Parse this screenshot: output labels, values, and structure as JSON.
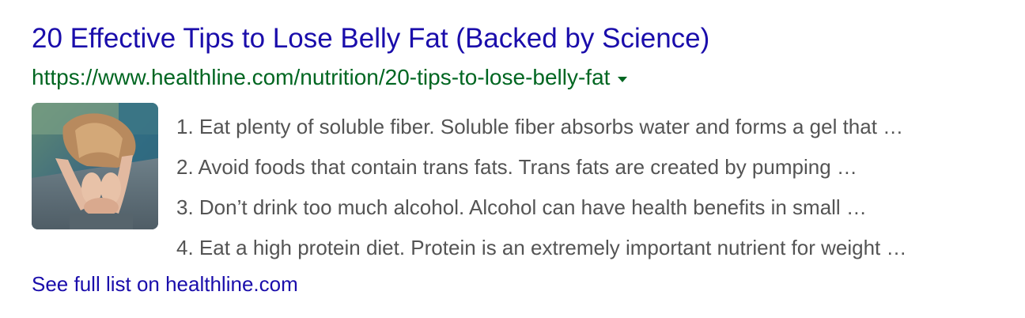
{
  "result": {
    "title": "20 Effective Tips to Lose Belly Fat (Backed by Science)",
    "url": "https://www.healthline.com/nutrition/20-tips-to-lose-belly-fat",
    "url_menu_icon": "caret-down-icon",
    "thumbnail_icon": "yoga-stretch-photo",
    "list_items": [
      {
        "text": "1. Eat plenty of soluble fiber. Soluble fiber absorbs water and forms a gel that …"
      },
      {
        "text": "2. Avoid foods that contain trans fats. Trans fats are created by pumping …"
      },
      {
        "text": "3. Don’t drink too much alcohol. Alcohol can have health benefits in small …"
      },
      {
        "text": "4. Eat a high protein diet. Protein is an extremely important nutrient for weight …"
      }
    ],
    "more_link": "See full list on healthline.com"
  },
  "colors": {
    "title": "#1a0dab",
    "url": "#006621",
    "snippet": "#545454",
    "link": "#1a0dab"
  }
}
